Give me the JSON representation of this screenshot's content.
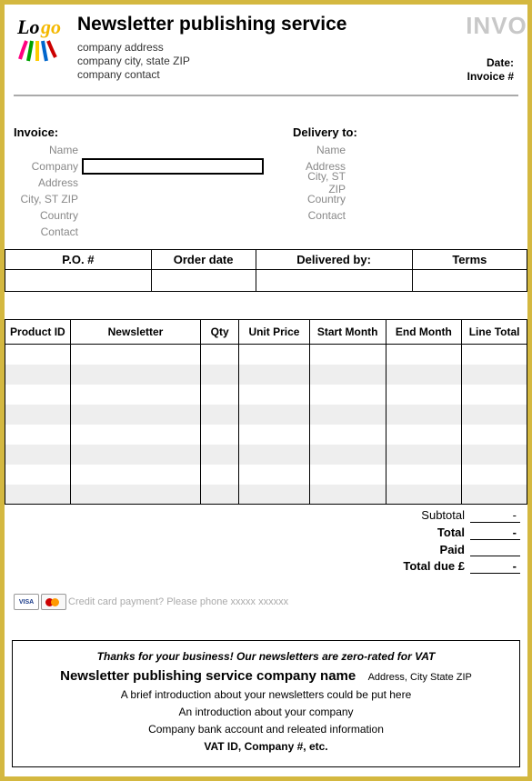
{
  "header": {
    "title": "Newsletter publishing service",
    "company_address": "company address",
    "company_city": "company city, state ZIP",
    "company_contact": "company contact",
    "invoice_word": "INVOI",
    "date_label": "Date:",
    "invoice_num_label": "Invoice #"
  },
  "invoice_to": {
    "title": "Invoice:",
    "labels": {
      "name": "Name",
      "company": "Company",
      "address": "Address",
      "city": "City, ST ZIP",
      "country": "Country",
      "contact": "Contact"
    }
  },
  "delivery_to": {
    "title": "Delivery to:",
    "labels": {
      "name": "Name",
      "address": "Address",
      "city": "City, ST ZIP",
      "country": "Country",
      "contact": "Contact"
    }
  },
  "order_headers": {
    "po": "P.O. #",
    "order_date": "Order date",
    "delivered_by": "Delivered by:",
    "terms": "Terms"
  },
  "item_headers": {
    "product_id": "Product ID",
    "newsletter": "Newsletter",
    "qty": "Qty",
    "unit_price": "Unit Price",
    "start_month": "Start Month",
    "end_month": "End Month",
    "line_total": "Line Total"
  },
  "totals": {
    "subtotal_label": "Subtotal",
    "subtotal_val": "-",
    "total_label": "Total",
    "total_val": "-",
    "paid_label": "Paid",
    "paid_val": "",
    "due_label": "Total due £",
    "due_val": "-"
  },
  "cc_text": "Credit card payment? Please phone xxxxx xxxxxx",
  "footer": {
    "thanks": "Thanks for your business! Our newsletters are zero-rated for VAT",
    "company_name": "Newsletter publishing service company name",
    "company_addr": "Address, City State ZIP",
    "intro1": "A brief introduction about your newsletters could be put here",
    "intro2": "An introduction about your company",
    "bank": "Company bank account and releated information",
    "vat": "VAT ID, Company #, etc."
  }
}
